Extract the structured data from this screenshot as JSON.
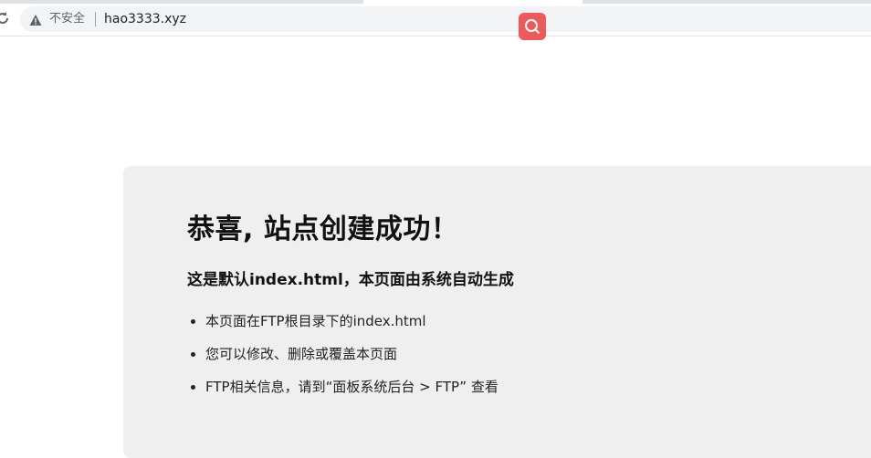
{
  "browser": {
    "insecure_label": "不安全",
    "url": "hao3333.xyz"
  },
  "page": {
    "heading": "恭喜, 站点创建成功！",
    "subheading": "这是默认index.html，本页面由系统自动生成",
    "items": [
      "本页面在FTP根目录下的index.html",
      "您可以修改、删除或覆盖本页面",
      "FTP相关信息，请到“面板系统后台 > FTP” 查看"
    ]
  },
  "colors": {
    "search_extension": "#ee5a5a",
    "card_background": "#efefef"
  }
}
